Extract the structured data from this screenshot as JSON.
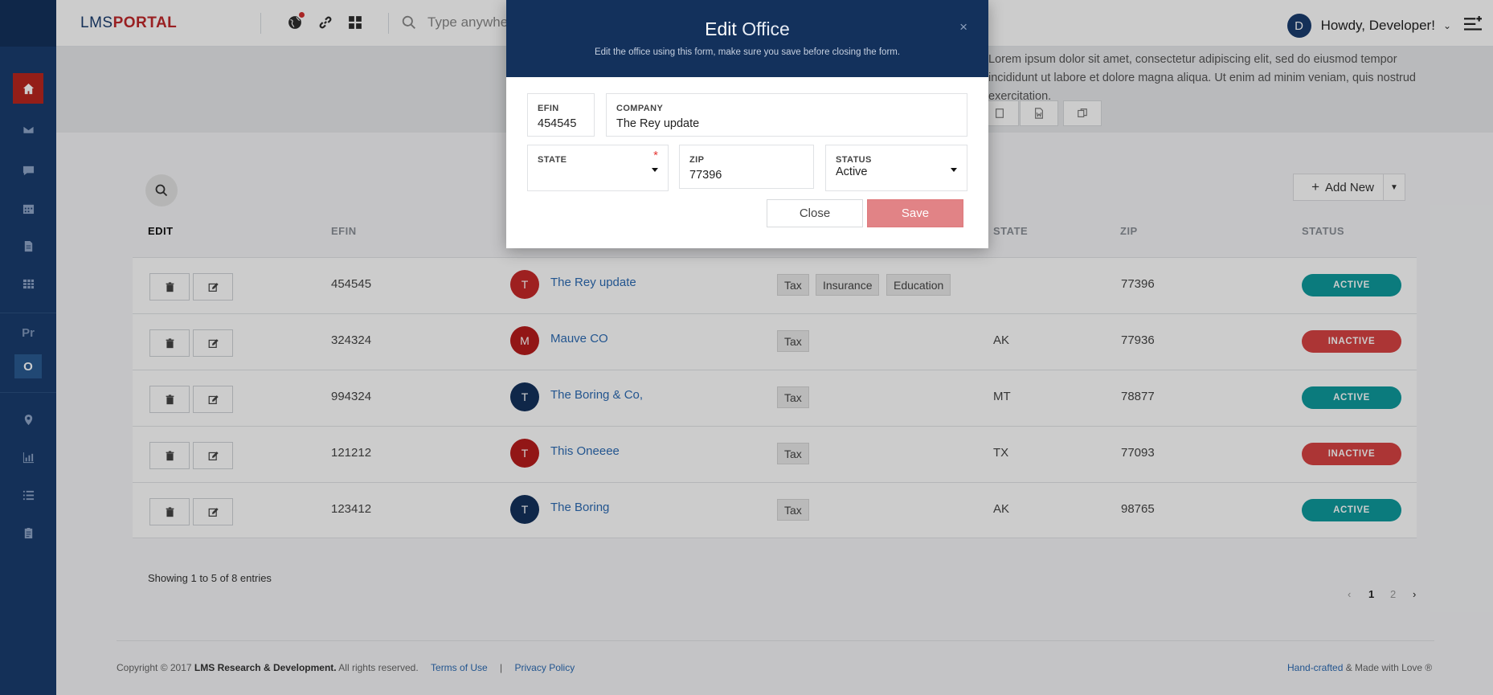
{
  "app": {
    "logo_light": "LMS",
    "logo_bold": "PORTAL"
  },
  "header": {
    "search_placeholder": "Type anywhere to search",
    "user_initial": "D",
    "user_greeting": "Howdy, Developer!"
  },
  "sidebar": {
    "icons": [
      "home-icon",
      "mail-icon",
      "chat-icon",
      "calendar-icon",
      "document-icon",
      "table-icon"
    ],
    "text_items": [
      "Pr",
      "O"
    ],
    "bottom_icons": [
      "location-icon",
      "chart-icon",
      "list-icon",
      "clipboard-icon"
    ]
  },
  "banner": {
    "text": "Lorem ipsum dolor sit amet, consectetur adipiscing elit, sed do eiusmod tempor incididunt ut labore et dolore magna aliqua. Ut enim ad minim veniam, quis nostrud exercitation."
  },
  "toolbar": {
    "add_new_label": "Add New"
  },
  "table": {
    "headers": {
      "edit": "EDIT",
      "efin": "EFIN",
      "state": "STATE",
      "zip": "ZIP",
      "status": "STATUS"
    },
    "rows": [
      {
        "efin": "454545",
        "initial": "T",
        "avatar_color": "#c62828",
        "company": "The Rey update",
        "tags": [
          "Tax",
          "Insurance",
          "Education"
        ],
        "state": "",
        "zip": "77396",
        "status": "ACTIVE",
        "status_color": "#0e9a9d"
      },
      {
        "efin": "324324",
        "initial": "M",
        "avatar_color": "#b71c1c",
        "company": "Mauve CO",
        "tags": [
          "Tax"
        ],
        "state": "AK",
        "zip": "77936",
        "status": "INACTIVE",
        "status_color": "#d84343"
      },
      {
        "efin": "994324",
        "initial": "T",
        "avatar_color": "#13315c",
        "company": "The Boring & Co,",
        "tags": [
          "Tax"
        ],
        "state": "MT",
        "zip": "78877",
        "status": "ACTIVE",
        "status_color": "#0e9a9d"
      },
      {
        "efin": "121212",
        "initial": "T",
        "avatar_color": "#b71c1c",
        "company": "This Oneeee",
        "tags": [
          "Tax"
        ],
        "state": "TX",
        "zip": "77093",
        "status": "INACTIVE",
        "status_color": "#d84343"
      },
      {
        "efin": "123412",
        "initial": "T",
        "avatar_color": "#13315c",
        "company": "The Boring",
        "tags": [
          "Tax"
        ],
        "state": "AK",
        "zip": "98765",
        "status": "ACTIVE",
        "status_color": "#0e9a9d"
      }
    ]
  },
  "pagination": {
    "summary": "Showing 1 to 5 of 8 entries",
    "prev": "‹",
    "pages": [
      "1",
      "2"
    ],
    "next": "›"
  },
  "footer": {
    "copyright_prefix": "Copyright © 2017 ",
    "company": "LMS Research & Development.",
    "rights": " All rights reserved.",
    "terms": "Terms of Use",
    "separator": "|",
    "privacy": "Privacy Policy",
    "handcrafted": "Hand-crafted",
    "made_with": " & Made with Love ®"
  },
  "modal": {
    "title_bold": "Edit",
    "title_light": "Office",
    "subtitle": "Edit the office using this form, make sure you save before closing the form.",
    "close_x": "×",
    "fields": {
      "efin": {
        "label": "EFIN",
        "value": "454545"
      },
      "company": {
        "label": "COMPANY",
        "value": "The Rey update"
      },
      "state": {
        "label": "STATE",
        "value": "",
        "required_mark": "*"
      },
      "zip": {
        "label": "ZIP",
        "value": "77396"
      },
      "status": {
        "label": "STATUS",
        "value": "Active"
      }
    },
    "close_label": "Close",
    "save_label": "Save"
  }
}
